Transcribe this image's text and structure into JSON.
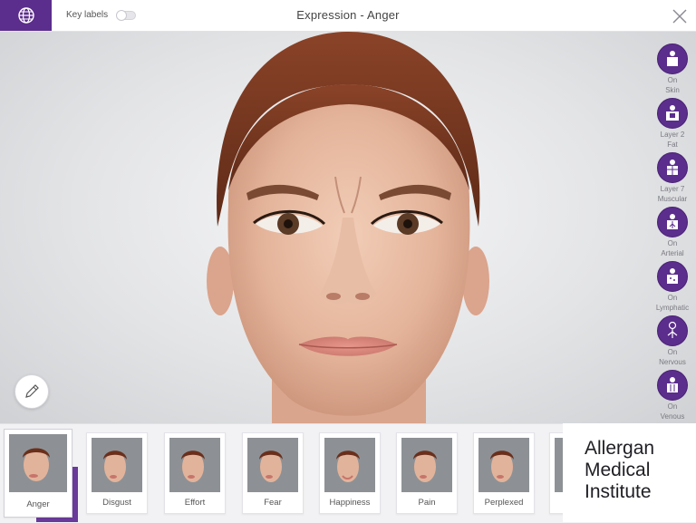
{
  "header": {
    "key_labels": "Key labels",
    "title": "Expression - Anger",
    "globe_icon": "globe-icon",
    "close_icon": "close-icon",
    "accent_color": "#5b2d8c"
  },
  "layers": [
    {
      "state": "On",
      "name": "Skin",
      "icon": "body-skin-icon"
    },
    {
      "state": "Layer 2",
      "name": "Fat",
      "icon": "body-fat-icon"
    },
    {
      "state": "Layer 7",
      "name": "Muscular",
      "icon": "body-muscular-icon"
    },
    {
      "state": "On",
      "name": "Arterial",
      "icon": "body-arterial-icon"
    },
    {
      "state": "On",
      "name": "Lymphatic",
      "icon": "body-lymphatic-icon"
    },
    {
      "state": "On",
      "name": "Nervous",
      "icon": "body-nervous-icon"
    },
    {
      "state": "On",
      "name": "Venous",
      "icon": "body-venous-icon"
    }
  ],
  "expressions": [
    {
      "label": "Anger",
      "selected": true
    },
    {
      "label": "Disgust"
    },
    {
      "label": "Effort"
    },
    {
      "label": "Fear"
    },
    {
      "label": "Happiness"
    },
    {
      "label": "Pain"
    },
    {
      "label": "Perplexed"
    }
  ],
  "brand": {
    "line1": "Allergan",
    "line2": "Medical",
    "line3": "Institute"
  },
  "tools": {
    "pen_icon": "pen-icon"
  }
}
